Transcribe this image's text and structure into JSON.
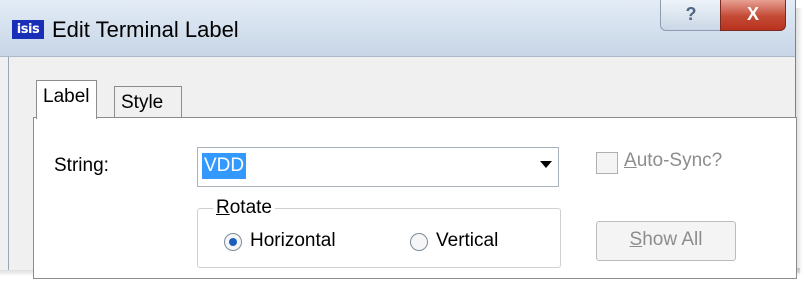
{
  "window": {
    "icon_text": "isis",
    "title": "Edit Terminal Label",
    "help_glyph": "?",
    "close_glyph": "X"
  },
  "tabs": [
    {
      "label": "Label",
      "active": true
    },
    {
      "label": "Style",
      "active": false
    }
  ],
  "string_field": {
    "label": "String:",
    "value": "VDD"
  },
  "auto_sync": {
    "label_accel": "A",
    "label_rest": "uto-Sync?",
    "checked": false,
    "enabled": false
  },
  "rotate": {
    "title_accel": "R",
    "title_rest": "otate",
    "options": [
      {
        "label": "Horizontal",
        "selected": true
      },
      {
        "label": "Vertical",
        "selected": false
      }
    ]
  },
  "show_all": {
    "label_accel": "S",
    "label_rest": "how All",
    "enabled": false
  },
  "colors": {
    "app_icon_bg": "#1a2fb8",
    "selection": "#3399ff",
    "close_button": "#c44a35"
  }
}
